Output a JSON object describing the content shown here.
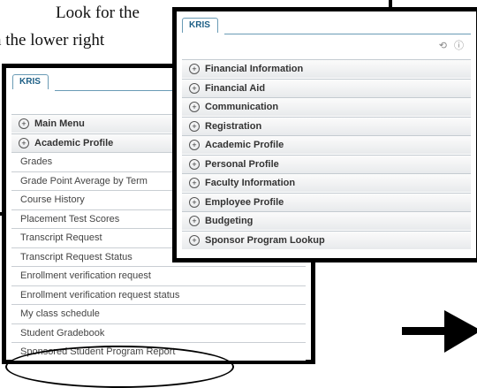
{
  "doc_text": {
    "line1": "Look for the",
    "line2": "n the lower right"
  },
  "back_panel": {
    "tab": "KRIS",
    "rows": [
      {
        "label": "Main Menu",
        "expand": true
      },
      {
        "label": "Academic Profile",
        "expand": true
      },
      {
        "label": "Grades",
        "expand": false
      },
      {
        "label": "Grade Point Average by Term",
        "expand": false
      },
      {
        "label": "Course History",
        "expand": false
      },
      {
        "label": "Placement Test Scores",
        "expand": false
      },
      {
        "label": "Transcript Request",
        "expand": false
      },
      {
        "label": "Transcript Request Status",
        "expand": false
      },
      {
        "label": "Enrollment verification request",
        "expand": false
      },
      {
        "label": "Enrollment verification request status",
        "expand": false
      },
      {
        "label": "My class schedule",
        "expand": false
      },
      {
        "label": "Student Gradebook",
        "expand": false
      },
      {
        "label": "Sponsored Student Program Report",
        "expand": false
      }
    ]
  },
  "front_panel": {
    "tab": "KRIS",
    "tools": {
      "refresh": "refresh-icon",
      "help": "help-icon"
    },
    "rows": [
      "Financial Information",
      "Financial Aid",
      "Communication",
      "Registration",
      "Academic Profile",
      "Personal Profile",
      "Faculty Information",
      "Employee Profile",
      "Budgeting",
      "Sponsor Program Lookup"
    ]
  },
  "colors": {
    "tab_text": "#1d5f86",
    "tab_border": "#6a9bb5",
    "frame": "#000000"
  }
}
